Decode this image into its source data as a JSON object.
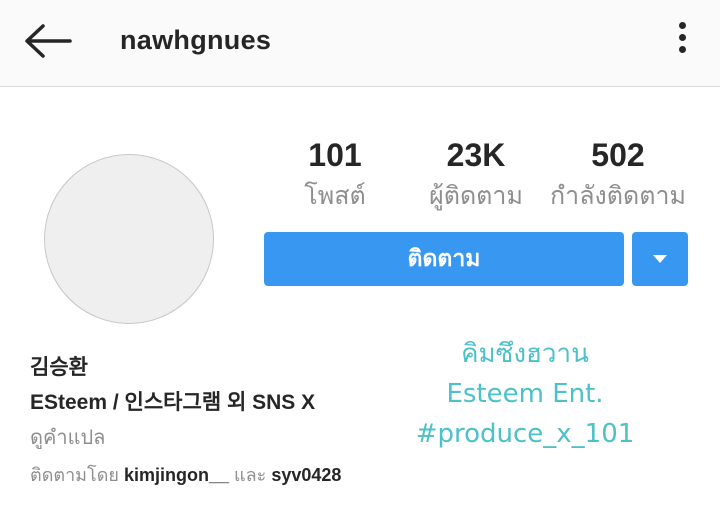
{
  "header": {
    "username": "nawhgnues",
    "back_icon": "arrow-left-icon",
    "more_icon": "more-vertical-icon"
  },
  "stats": [
    {
      "value": "101",
      "label": "โพสต์"
    },
    {
      "value": "23K",
      "label": "ผู้ติดตาม"
    },
    {
      "value": "502",
      "label": "กำลังติดตาม"
    }
  ],
  "actions": {
    "follow_label": "ติดตาม",
    "dropdown_icon": "caret-down-icon"
  },
  "bio": {
    "name": "김승환",
    "text": "ESteem / 인스타그램 외 SNS X",
    "translate_label": "ดูคำแปล"
  },
  "followed_by": {
    "prefix": "ติดตามโดย",
    "user1": "kimjingon__",
    "conjunction": "และ",
    "user2": "syv0428"
  },
  "overlay": {
    "line1": "คิมซึงฮวาน",
    "line2": "Esteem Ent.",
    "line3": "#produce_x_101"
  },
  "colors": {
    "accent": "#3897f0",
    "overlay_text": "#4cc1c9",
    "muted_text": "#8e8e8e"
  }
}
